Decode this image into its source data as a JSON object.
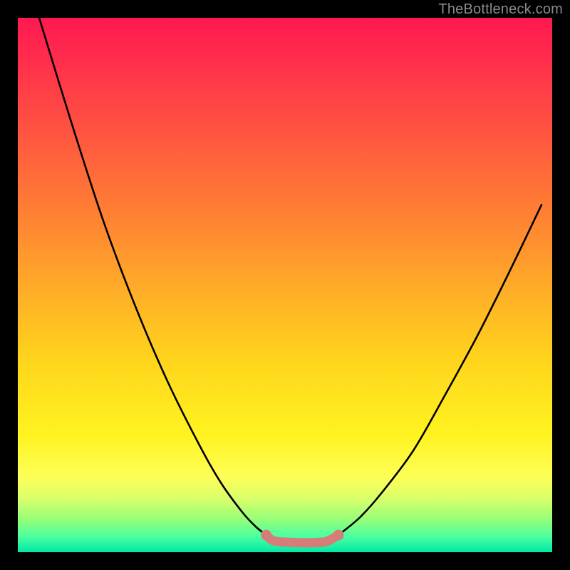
{
  "watermark": "TheBottleneck.com",
  "chart_data": {
    "type": "line",
    "title": "",
    "xlabel": "",
    "ylabel": "",
    "xlim": [
      0,
      100
    ],
    "ylim": [
      0,
      100
    ],
    "grid": false,
    "legend": false,
    "series": [
      {
        "name": "left-curve",
        "stroke": "#000000",
        "x": [
          4.0,
          10.0,
          16.0,
          22.0,
          28.0,
          34.0,
          38.0,
          42.0,
          44.5,
          46.5
        ],
        "values": [
          100.0,
          80.5,
          62.0,
          46.0,
          32.0,
          20.0,
          13.0,
          7.5,
          4.8,
          3.2
        ]
      },
      {
        "name": "right-curve",
        "stroke": "#000000",
        "x": [
          60.0,
          64.0,
          68.0,
          74.0,
          80.0,
          86.0,
          92.0,
          98.0
        ],
        "values": [
          3.2,
          6.5,
          11.0,
          19.0,
          29.5,
          40.5,
          52.5,
          65.0
        ]
      },
      {
        "name": "valley-band",
        "stroke": "#d77d79",
        "x": [
          46.5,
          48.0,
          52.0,
          56.0,
          58.0,
          60.0
        ],
        "values": [
          3.2,
          2.1,
          1.8,
          1.8,
          2.1,
          3.2
        ]
      }
    ],
    "markers": [
      {
        "name": "left-dot",
        "x": 46.5,
        "y": 3.2,
        "color": "#d77d79",
        "r": 1.0
      },
      {
        "name": "right-dot",
        "x": 60.0,
        "y": 3.2,
        "color": "#d77d79",
        "r": 1.0
      }
    ]
  }
}
